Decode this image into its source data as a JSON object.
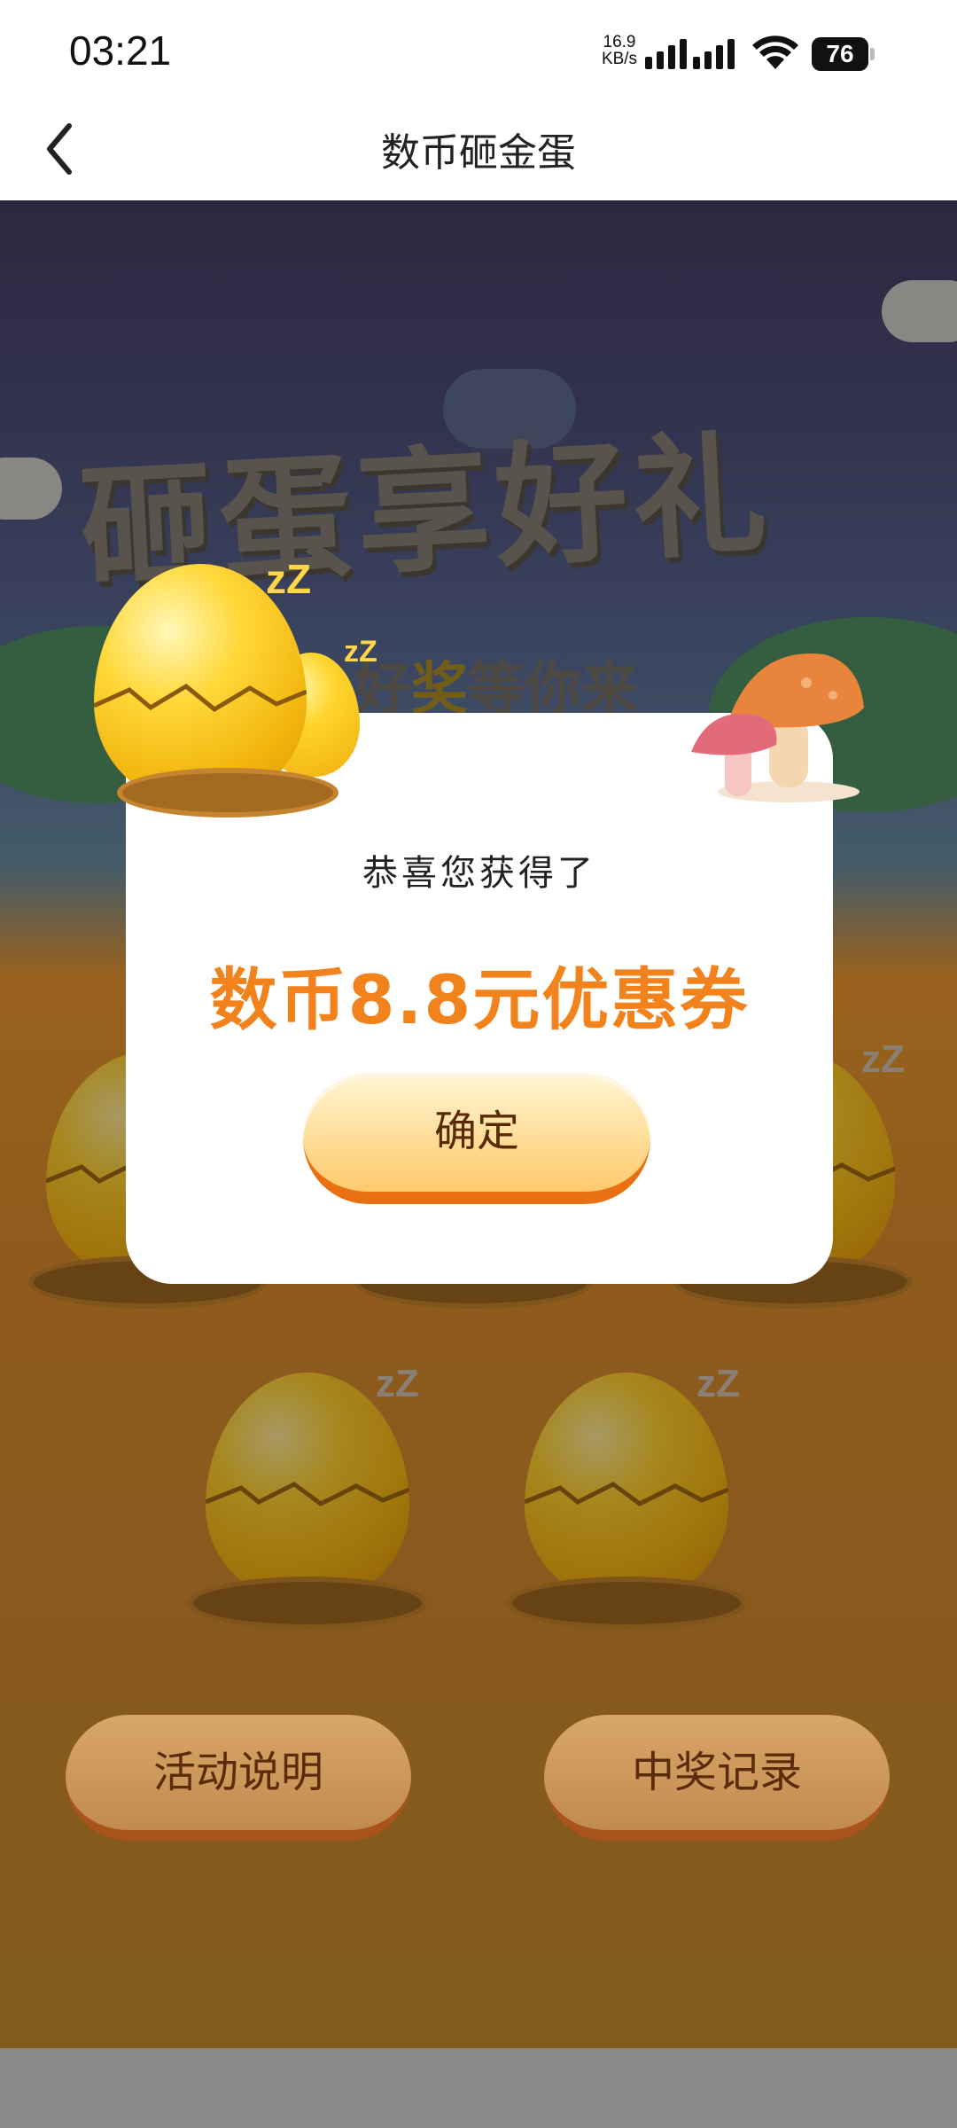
{
  "status_bar": {
    "time": "03:21",
    "net_speed_value": "16.9",
    "net_speed_unit": "KB/s",
    "battery": "76",
    "icons": [
      "signal-icon",
      "signal-icon",
      "wifi-icon",
      "battery-icon"
    ]
  },
  "nav": {
    "title": "数币砸金蛋",
    "back_icon": "chevron-left-icon"
  },
  "banner": {
    "title": "砸蛋享好礼",
    "subtitle_a": "好",
    "subtitle_hl": "奖",
    "subtitle_b": "等你来"
  },
  "modal": {
    "heading": "恭喜您获得了",
    "prize": "数币8.8元优惠券",
    "confirm_label": "确定"
  },
  "actions": {
    "rules_label": "活动说明",
    "records_label": "中奖记录"
  },
  "colors": {
    "accent_orange": "#f2821c",
    "button_border": "#e86f12",
    "button_text": "#5a2a05"
  }
}
